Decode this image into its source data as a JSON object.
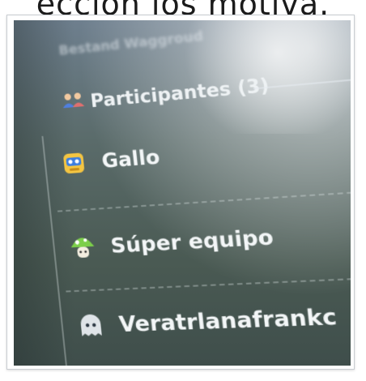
{
  "caption": {
    "text": "ección los motiva."
  },
  "panel": {
    "header_label": "Bestand Waggroud",
    "title": "Participantes (3)",
    "title_icon": "people-icon"
  },
  "participants": [
    {
      "name": "Gallo",
      "avatar": "robot-avatar-icon",
      "color": "#f4c542"
    },
    {
      "name": "Súper equipo",
      "avatar": "mushroom-avatar-icon",
      "color": "#7ccf4a"
    },
    {
      "name": "Veratrlanafrankc",
      "avatar": "ghost-avatar-icon",
      "color": "#dfe4e8"
    }
  ],
  "colors": {
    "screen_bg": "#5a6b6a",
    "text": "#f3f6f7"
  }
}
